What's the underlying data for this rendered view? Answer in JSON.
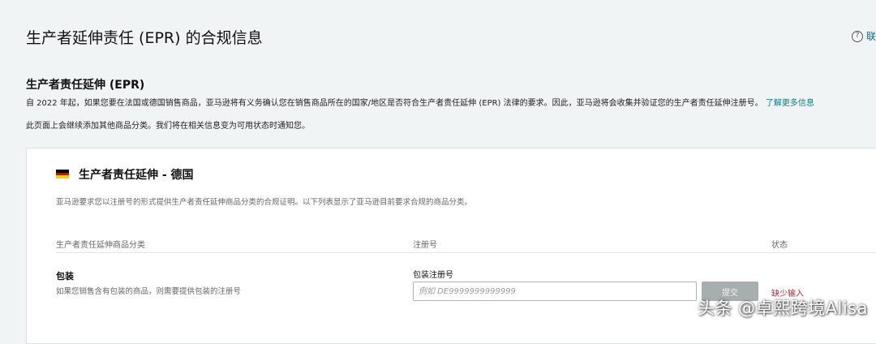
{
  "header": {
    "title": "生产者延伸责任 (EPR) 的合规信息",
    "help_label": "联"
  },
  "section": {
    "heading": "生产者责任延伸 (EPR)",
    "intro_text": "自 2022 年起，如果您要在法国或德国销售商品，亚马逊将有义务确认您在销售商品所在的国家/地区是否符合生产者责任延伸 (EPR) 法律的要求。因此，亚马逊将会收集并验证您的生产者责任延伸注册号。",
    "learn_more": "了解更多信息",
    "intro_text_2": "此页面上会继续添加其他商品分类。我们将在相关信息变为可用状态时通知您。"
  },
  "card": {
    "flag_colors": [
      "#000000",
      "#dd0000",
      "#ffce00"
    ],
    "title": "生产者责任延伸 - 德国",
    "description": "亚马逊要求您以注册号的形式提供生产者责任延伸商品分类的合规证明。以下列表显示了亚马逊目前要求合规的商品分类。",
    "columns": {
      "category": "生产者责任延伸商品分类",
      "registration": "注册号",
      "status": "状态"
    },
    "row": {
      "category_name": "包装",
      "category_desc": "如果您销售含有包装的商品，则需要提供包装的注册号",
      "field_label": "包装注册号",
      "input_placeholder": "例如 DE9999999999999",
      "input_value": "",
      "submit_label": "提交",
      "status": "缺少输入"
    }
  },
  "watermark": "头条 @卓熙跨境Alisa",
  "colors": {
    "background": "#f1f4f4",
    "link": "#0a7a86",
    "status_missing": "#b3263a",
    "button_disabled": "#a7aeae"
  }
}
